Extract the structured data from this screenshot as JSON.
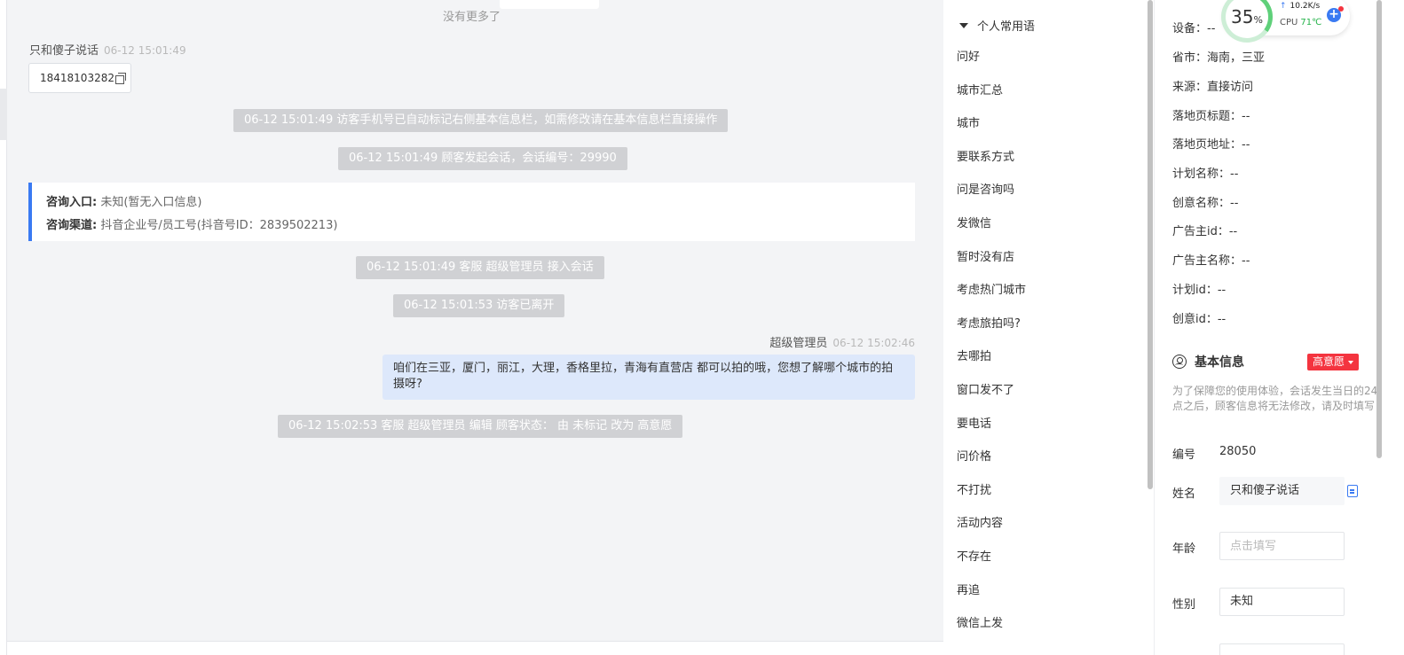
{
  "chat": {
    "no_more": "没有更多了",
    "visitor": {
      "name": "只和傻子说话",
      "time": "06-12 15:01:49",
      "phone": "18418103282"
    },
    "system_messages": [
      "06-12 15:01:49 访客手机号已自动标记右侧基本信息栏，如需修改请在基本信息栏直接操作",
      "06-12 15:01:49 顾客发起会话，会话编号：29990",
      "06-12 15:01:49 客服 超级管理员 接入会话",
      "06-12 15:01:53 访客已离开",
      "06-12 15:02:53 客服 超级管理员 编辑 顾客状态： 由 未标记 改为 高意愿"
    ],
    "info_card": {
      "entry_label": "咨询入口:",
      "entry_value": "未知(暂无入口信息)",
      "channel_label": "咨询渠道:",
      "channel_value": "抖音企业号/员工号(抖音号ID：2839502213)"
    },
    "agent": {
      "name": "超级管理员",
      "time": "06-12 15:02:46",
      "message": "咱们在三亚，厦门，丽江，大理，香格里拉，青海有直营店 都可以拍的哦，您想了解哪个城市的拍摄呀?"
    }
  },
  "phrases": {
    "header": "个人常用语",
    "items": [
      "问好",
      "城市汇总",
      "城市",
      "要联系方式",
      "问是咨询吗",
      "发微信",
      "暂时没有店",
      "考虑热门城市",
      "考虑旅拍吗?",
      "去哪拍",
      "窗口发不了",
      "要电话",
      "问价格",
      "不打扰",
      "活动内容",
      "不存在",
      "再追",
      "微信上发"
    ]
  },
  "customer": {
    "fields": [
      "设备：--",
      "省市：海南，三亚",
      "来源：直接访问",
      "落地页标题：--",
      "落地页地址：--",
      "计划名称：--",
      "创意名称：--",
      "广告主id：--",
      "广告主名称：--",
      "计划id：--",
      "创意id：--"
    ],
    "basic_info": {
      "title": "基本信息",
      "intent_badge": "高意愿",
      "hint": "为了保障您的使用体验，会话发生当日的24点之后，顾客信息将无法修改，请及时填写",
      "id_label": "编号",
      "id_value": "28050",
      "name_label": "姓名",
      "name_value": "只和傻子说话",
      "age_label": "年龄",
      "age_placeholder": "点击填写",
      "gender_label": "性别",
      "gender_value": "未知"
    }
  },
  "monitor": {
    "percent": "35",
    "percent_unit": "%",
    "net_speed": "10.2K/s",
    "cpu_label": "CPU",
    "cpu_temp": "71℃",
    "usage_fraction": 0.35
  },
  "colors": {
    "accent_blue": "#3a7af2",
    "badge_red": "#f4343f",
    "monitor_green": "#5fd07a",
    "agent_bubble": "#dde8fb",
    "system_pill": "#d0d1d4"
  }
}
